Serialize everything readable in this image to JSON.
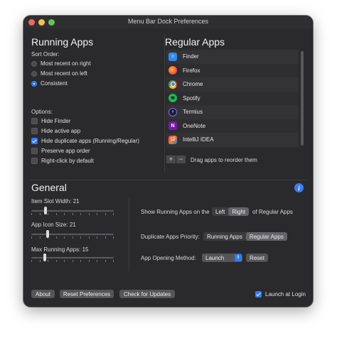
{
  "window": {
    "title": "Menu Bar Dock Preferences"
  },
  "running": {
    "title": "Running Apps",
    "sort_label": "Sort Order:",
    "sort_options": [
      "Most recent on right",
      "Most recent on left",
      "Consistent"
    ],
    "sort_selected": "Consistent",
    "options_label": "Options:",
    "options": [
      {
        "label": "Hide Finder",
        "checked": false
      },
      {
        "label": "Hide active app",
        "checked": false
      },
      {
        "label": "Hide duplicate apps (Running/Regular)",
        "checked": true
      },
      {
        "label": "Preserve app order",
        "checked": false
      },
      {
        "label": "Right-click by default",
        "checked": false
      }
    ]
  },
  "regular": {
    "title": "Regular Apps",
    "apps": [
      {
        "name": "Finder",
        "icon": "finder-icon",
        "color": "#2d8cf0"
      },
      {
        "name": "Firefox",
        "icon": "firefox-icon",
        "color": "#ff7139"
      },
      {
        "name": "Chrome",
        "icon": "chrome-icon",
        "color": "#34a853"
      },
      {
        "name": "Spotify",
        "icon": "spotify-icon",
        "color": "#1db954"
      },
      {
        "name": "Termius",
        "icon": "termius-icon",
        "color": "#1b1b3a"
      },
      {
        "name": "OneNote",
        "icon": "onenote-icon",
        "color": "#7719aa"
      },
      {
        "name": "IntelliJ IDEA",
        "icon": "intellij-icon",
        "color": "#c8196d"
      }
    ],
    "add_label": "+",
    "remove_label": "−",
    "drag_hint": "Drag apps to reorder them"
  },
  "general": {
    "title": "General",
    "info_icon": "i",
    "slot_width_label": "Item Slot Width:",
    "slot_width_value": "21",
    "slot_width_fraction": 0.17,
    "icon_size_label": "App Icon Size:",
    "icon_size_value": "21",
    "icon_size_fraction": 0.2,
    "max_running_label": "Max Running Apps:",
    "max_running_value": "15",
    "max_running_fraction": 0.16,
    "show_running_label": "Show Running Apps on the",
    "show_running_options": [
      "Left",
      "Right"
    ],
    "show_running_selected": "Right",
    "show_running_suffix": "of Regular Apps",
    "duplicate_priority_label": "Duplicate Apps Priority:",
    "duplicate_priority_options": [
      "Running Apps",
      "Regular Apps"
    ],
    "duplicate_priority_selected": "Regular Apps",
    "opening_method_label": "App Opening Method:",
    "opening_method_value": "Launch",
    "reset_label": "Reset"
  },
  "footer": {
    "about": "About",
    "reset_prefs": "Reset Preferences",
    "check_updates": "Check for Updates",
    "launch_at_login": "Launch at Login",
    "launch_at_login_checked": true
  },
  "colors": {
    "accent": "#2f7cf6",
    "window_bg": "#2a2a2c"
  }
}
